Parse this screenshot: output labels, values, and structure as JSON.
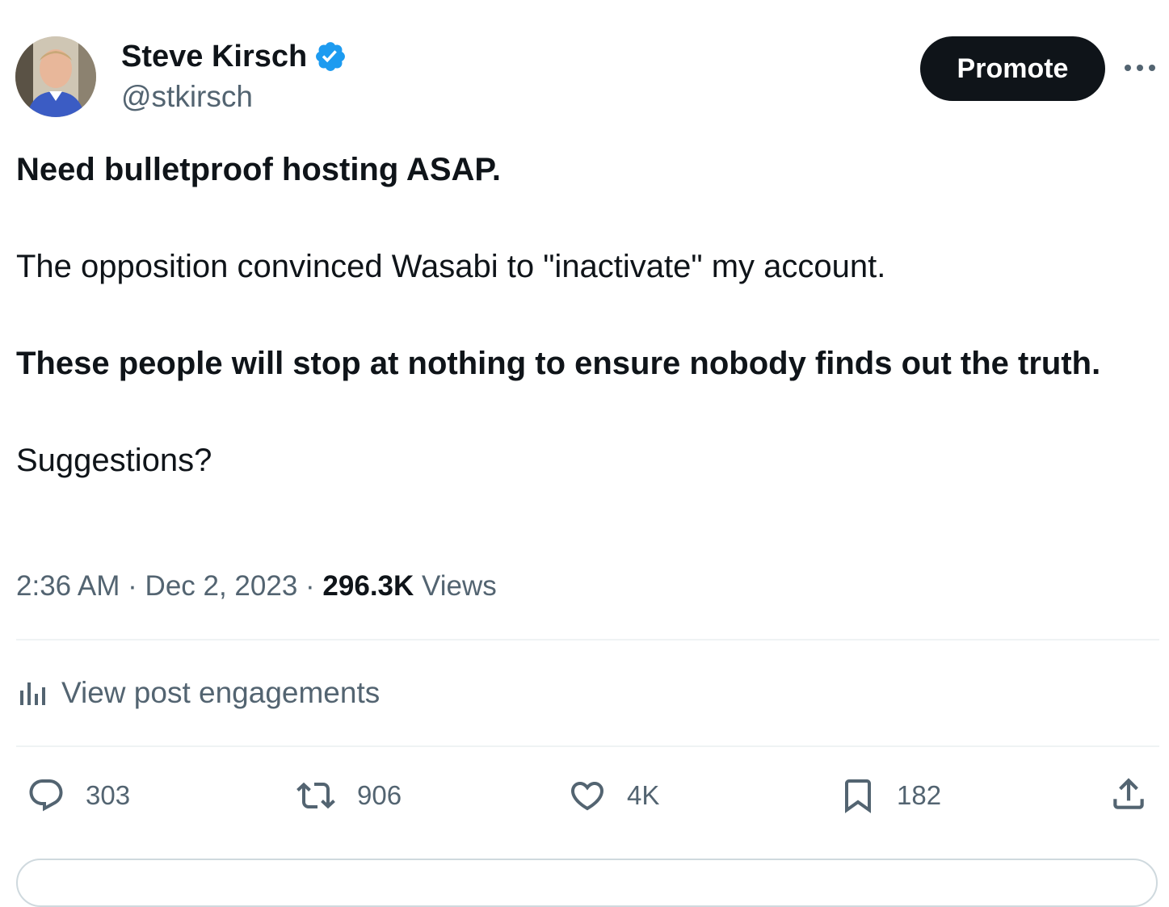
{
  "author": {
    "name": "Steve Kirsch",
    "handle": "@stkirsch",
    "verified": true,
    "verified_color": "#1d9bf0"
  },
  "header": {
    "promote_label": "Promote",
    "more_icon": "more-horizontal-icon"
  },
  "post": {
    "paragraphs": [
      {
        "text": "Need bulletproof hosting ASAP.",
        "bold": true
      },
      {
        "text": "The opposition convinced Wasabi to \"inactivate\" my account.",
        "bold": false
      },
      {
        "text": "These people will stop at nothing to ensure nobody finds out the truth.",
        "bold": true
      },
      {
        "text": "Suggestions?",
        "bold": false
      }
    ]
  },
  "meta": {
    "time": "2:36 AM",
    "separator": "·",
    "date": "Dec 2, 2023",
    "views_count": "296.3K",
    "views_label": "Views"
  },
  "engagements": {
    "label": "View post engagements",
    "icon": "analytics-icon"
  },
  "actions": {
    "replies": "303",
    "reposts": "906",
    "likes": "4K",
    "bookmarks": "182",
    "icons": [
      "reply-icon",
      "repost-icon",
      "like-icon",
      "bookmark-icon",
      "share-icon"
    ]
  },
  "colors": {
    "text": "#0f1419",
    "secondary": "#536471",
    "divider": "#eff3f4",
    "button_bg": "#0f1419"
  }
}
